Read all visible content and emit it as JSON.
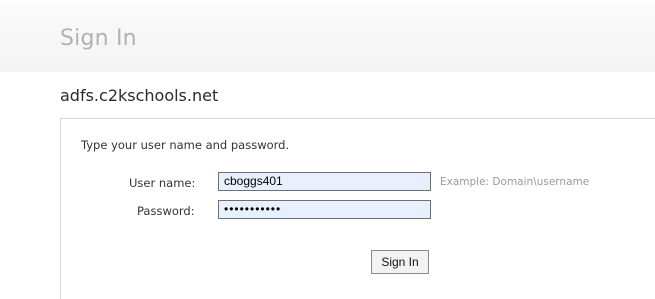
{
  "header": {
    "title": "Sign In"
  },
  "server": {
    "name": "adfs.c2kschools.net"
  },
  "form": {
    "instructions": "Type your user name and password.",
    "username_label": "User name:",
    "username_value": "cboggs401",
    "username_hint": "Example: Domain\\username",
    "password_label": "Password:",
    "password_value": "•••••••••••",
    "submit_label": "Sign In"
  }
}
